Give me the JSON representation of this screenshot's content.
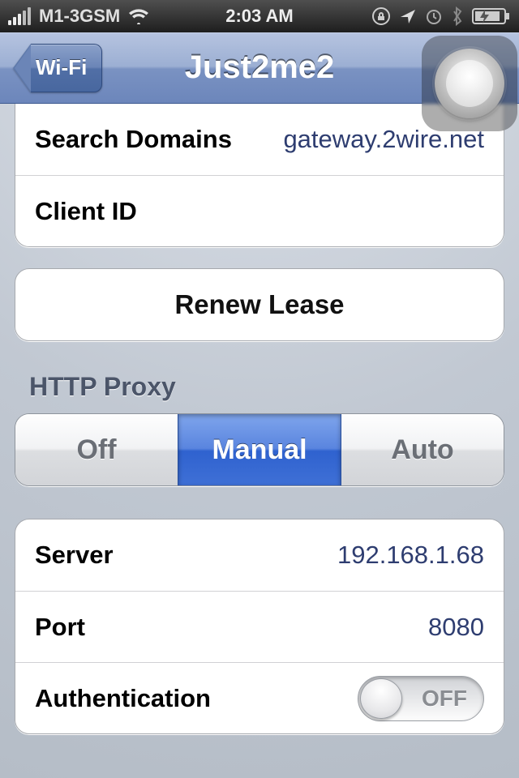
{
  "status_bar": {
    "carrier": "M1-3GSM",
    "time": "2:03 AM"
  },
  "nav": {
    "back_label": "Wi-Fi",
    "title": "Just2me2"
  },
  "top_group": {
    "search_domains_label": "Search Domains",
    "search_domains_value": "gateway.2wire.net",
    "client_id_label": "Client ID",
    "client_id_value": ""
  },
  "renew": {
    "label": "Renew Lease"
  },
  "proxy": {
    "header": "HTTP Proxy",
    "options": {
      "off": "Off",
      "manual": "Manual",
      "auto": "Auto"
    },
    "selected": "manual",
    "server_label": "Server",
    "server_value": "192.168.1.68",
    "port_label": "Port",
    "port_value": "8080",
    "auth_label": "Authentication",
    "auth_state": "OFF"
  }
}
